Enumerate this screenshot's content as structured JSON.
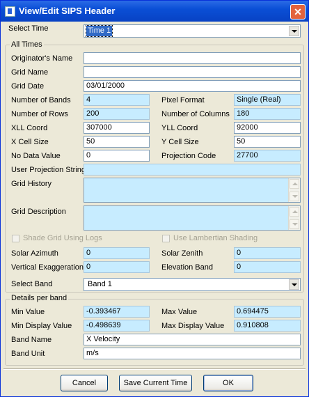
{
  "window": {
    "title": "View/Edit SIPS Header",
    "close": "✕"
  },
  "select_time": {
    "label": "Select Time",
    "value": "Time 1"
  },
  "all_times": {
    "label": "All Times",
    "originator_name": {
      "label": "Originator's Name",
      "value": ""
    },
    "grid_name": {
      "label": "Grid Name",
      "value": ""
    },
    "grid_date": {
      "label": "Grid Date",
      "value": "03/01/2000"
    },
    "num_bands": {
      "label": "Number of Bands",
      "value": "4"
    },
    "pixel_format": {
      "label": "Pixel Format",
      "value": "Single (Real)"
    },
    "num_rows": {
      "label": "Number of Rows",
      "value": "200"
    },
    "num_cols": {
      "label": "Number of Columns",
      "value": "180"
    },
    "xll": {
      "label": "XLL Coord",
      "value": "307000"
    },
    "yll": {
      "label": "YLL Coord",
      "value": "92000"
    },
    "x_cell": {
      "label": "X Cell Size",
      "value": "50"
    },
    "y_cell": {
      "label": "Y Cell Size",
      "value": "50"
    },
    "no_data": {
      "label": "No Data Value",
      "value": "0"
    },
    "proj_code": {
      "label": "Projection Code",
      "value": "27700"
    },
    "user_proj": {
      "label": "User Projection String",
      "value": ""
    },
    "grid_history": {
      "label": "Grid History"
    },
    "grid_description": {
      "label": "Grid Description"
    },
    "shade_logs": {
      "label": "Shade Grid Using Logs",
      "checked": false
    },
    "lambertian": {
      "label": "Use Lambertian Shading",
      "checked": false
    },
    "solar_azimuth": {
      "label": "Solar Azimuth",
      "value": "0"
    },
    "solar_zenith": {
      "label": "Solar Zenith",
      "value": "0"
    },
    "vert_exag": {
      "label": "Vertical Exaggeration",
      "value": "0"
    },
    "elev_band": {
      "label": "Elevation Band",
      "value": "0"
    }
  },
  "select_band": {
    "label": "Select Band",
    "value": "Band 1"
  },
  "details": {
    "label": "Details per band",
    "min_value": {
      "label": "Min Value",
      "value": "-0.393467"
    },
    "max_value": {
      "label": "Max Value",
      "value": "0.694475"
    },
    "min_display": {
      "label": "Min Display Value",
      "value": "-0.498639"
    },
    "max_display": {
      "label": "Max Display Value",
      "value": "0.910808"
    },
    "band_name": {
      "label": "Band Name",
      "value": "X Velocity"
    },
    "band_unit": {
      "label": "Band Unit",
      "value": "m/s"
    }
  },
  "buttons": {
    "cancel": "Cancel",
    "save": "Save Current Time",
    "ok": "OK"
  }
}
